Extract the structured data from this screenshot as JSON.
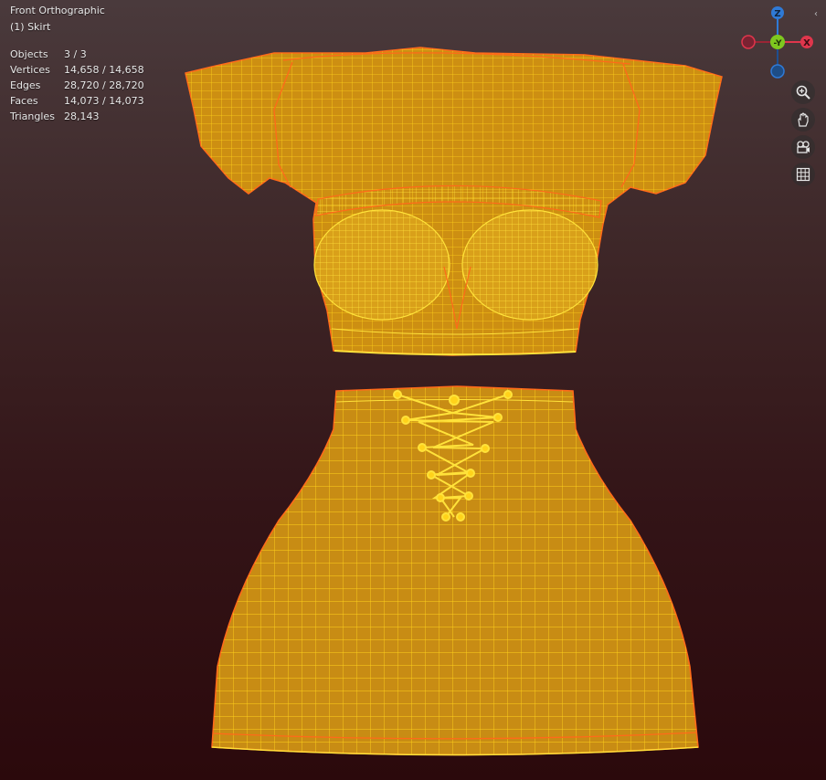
{
  "viewport": {
    "view_name": "Front Orthographic",
    "active_object": "(1) Skirt",
    "stats": [
      {
        "label": "Objects",
        "value": "3 / 3"
      },
      {
        "label": "Vertices",
        "value": "14,658 / 14,658"
      },
      {
        "label": "Edges",
        "value": "28,720 / 28,720"
      },
      {
        "label": "Faces",
        "value": "14,073 / 14,073"
      },
      {
        "label": "Triangles",
        "value": "28,143"
      }
    ]
  },
  "gizmo": {
    "z_label": "Z",
    "neg_y_label": "-Y",
    "x_label": "X",
    "colors": {
      "z": "#2f7ad6",
      "y": "#7ec81f",
      "x": "#e0364c"
    }
  },
  "nav_buttons": [
    {
      "name": "zoom-icon"
    },
    {
      "name": "hand-pan-icon"
    },
    {
      "name": "camera-view-icon"
    },
    {
      "name": "ortho-grid-icon"
    }
  ],
  "mesh_colors": {
    "wire": "#ffd21a",
    "fill": "#d89a12",
    "outline": "#ff6a1a"
  }
}
